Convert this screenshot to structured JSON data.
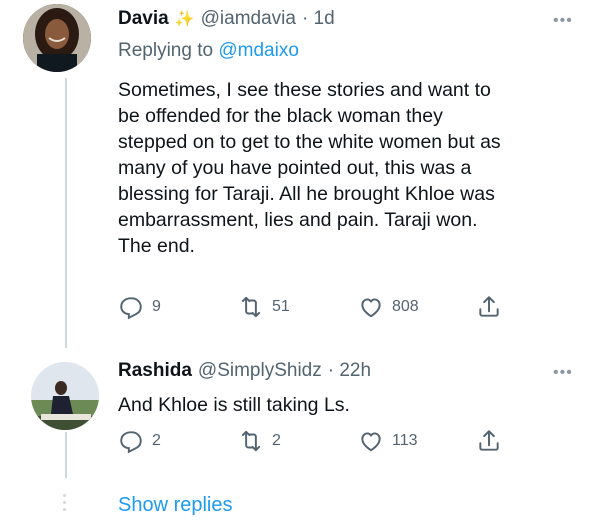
{
  "tweets": [
    {
      "name": "Davia",
      "badge": "✨",
      "handle": "@iamdavia",
      "time": "· 1d",
      "reply_prefix": "Replying to",
      "reply_to": "@mdaixo",
      "text_lines": [
        "Sometimes, I see these stories and want to",
        "be offended for the black woman they",
        "stepped on to get to the white women but as",
        "many of you have pointed out, this was a",
        "blessing for Taraji. All he brought Khloe was",
        "embarrassment, lies and pain. Taraji won.",
        "The end."
      ],
      "replies": "9",
      "retweets": "51",
      "likes": "808"
    },
    {
      "name": "Rashida",
      "handle": "@SimplyShidz",
      "time": "· 22h",
      "text": "And Khloe is still taking Ls.",
      "replies": "2",
      "retweets": "2",
      "likes": "113"
    }
  ],
  "show_replies": "Show replies",
  "icons": [
    "more-icon",
    "reply-icon",
    "retweet-icon",
    "like-icon",
    "share-icon"
  ],
  "colors": {
    "link": "#1d9bf0",
    "muted": "#536471",
    "text": "#0f1419",
    "line": "#cfd9de"
  }
}
